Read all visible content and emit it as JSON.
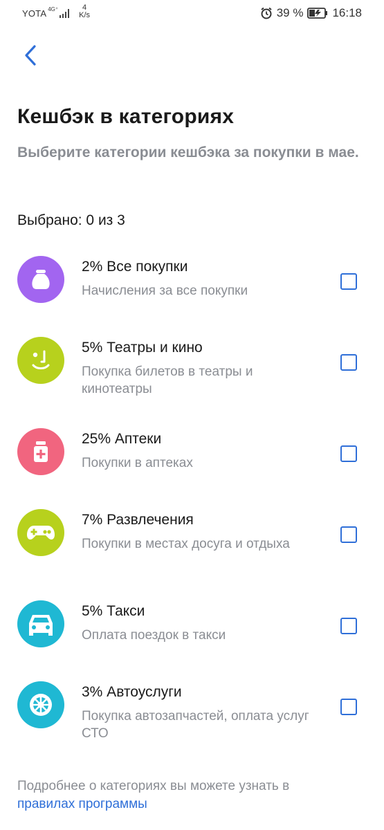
{
  "status_bar": {
    "carrier": "YOTA",
    "network": "4G⁺",
    "speed_value": "4",
    "speed_unit": "K/s",
    "battery": "39 %",
    "time": "16:18"
  },
  "header": {
    "title": "Кешбэк в категориях",
    "subtitle": "Выберите категории кешбэка за покупки в мае."
  },
  "selection": {
    "label": "Выбрано: 0 из 3"
  },
  "categories": [
    {
      "title": "2% Все покупки",
      "description": "Начисления за все покупки",
      "icon": "bag-icon",
      "color": "#a265f0",
      "checked": false
    },
    {
      "title": "5% Театры и кино",
      "description": "Покупка билетов в театры и кинотеатры",
      "icon": "face-icon",
      "color": "#b7d11d",
      "checked": false
    },
    {
      "title": "25% Аптеки",
      "description": "Покупки в аптеках",
      "icon": "medicine-icon",
      "color": "#f1657f",
      "checked": false
    },
    {
      "title": "7% Развлечения",
      "description": "Покупки в местах досуга и отдыха",
      "icon": "gamepad-icon",
      "color": "#b7d11d",
      "checked": false
    },
    {
      "title": "5% Такси",
      "description": "Оплата поездок в такси",
      "icon": "car-icon",
      "color": "#1fb8d3",
      "checked": false
    },
    {
      "title": "3% Автоуслуги",
      "description": "Покупка автозапчастей, оплата услуг СТО",
      "icon": "wheel-icon",
      "color": "#1fb8d3",
      "checked": false
    }
  ],
  "footer": {
    "text": "Подробнее о категориях вы можете узнать в",
    "link": "правилах программы"
  },
  "colors": {
    "accent": "#2f6fd8",
    "muted": "#8a8d93"
  }
}
